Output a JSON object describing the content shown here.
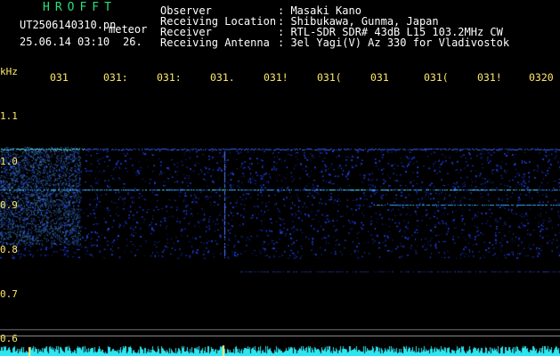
{
  "header": {
    "program": "HROFFT",
    "filename": "UT2506140310.pn",
    "mode": "meteor",
    "datetime": "25.06.14 03:10",
    "count": "26.",
    "fields": [
      {
        "label": "Observer",
        "value": ": Masaki Kano"
      },
      {
        "label": "Receiving Location",
        "value": ": Shibukawa, Gunma, Japan"
      },
      {
        "label": "Receiver",
        "value": ": RTL-SDR SDR# 43dB L15 103.2MHz CW"
      },
      {
        "label": "Receiving Antenna",
        "value": ": 3el Yagi(V) Az 330 for Vladivostok"
      }
    ]
  },
  "axis": {
    "unit": "kHz",
    "y_ticks": [
      "1.1",
      "1.0",
      "0.9",
      "0.8",
      "0.7",
      "0.6"
    ],
    "x_ticks": [
      "031",
      "031:",
      "031:",
      "031.",
      "031!",
      "031(",
      "031",
      "031(",
      "031!",
      "0320"
    ]
  },
  "colors": {
    "text": "#ffffff",
    "title_green": "#27e07a",
    "axis_yellow": "#ffe86b",
    "signal_blue": "#2a4cff",
    "signal_cyan": "#4fe8ff"
  }
}
